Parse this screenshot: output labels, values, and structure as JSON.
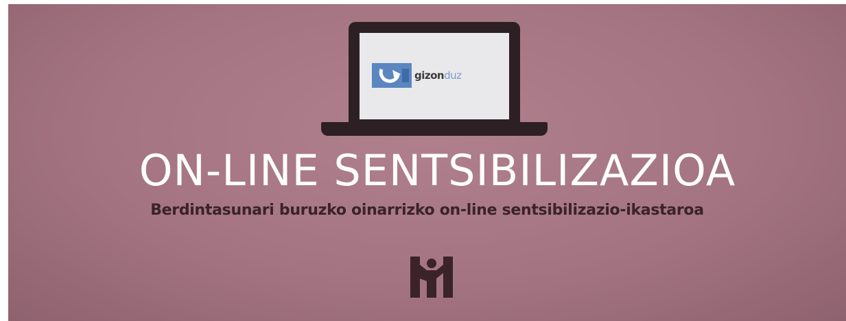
{
  "banner": {
    "logo_text_part1": "gizon",
    "logo_text_part2": "duz",
    "title": "ON-LINE SENTSIBILIZAZIOA",
    "subtitle": "Berdintasunari buruzko oinarrizko on-line sentsibilizazio-ikastaroa"
  },
  "icons": {
    "laptop": "laptop-icon",
    "logo_mark": "gizonduz-logo-icon",
    "emblem": "people-emblem-icon"
  },
  "colors": {
    "background": "#a47482",
    "title": "#ffffff",
    "subtitle": "#3a2329",
    "laptop": "#2d2024",
    "logo_blue": "#5b86bf"
  }
}
